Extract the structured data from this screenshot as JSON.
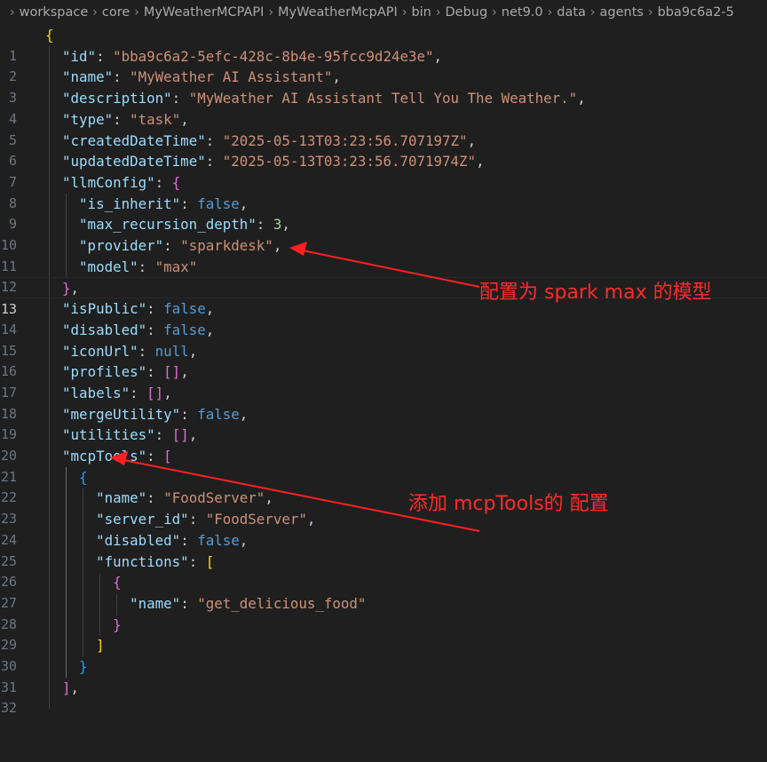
{
  "breadcrumb": [
    "workspace",
    "core",
    "MyWeatherMCPAPI",
    "MyWeatherMcpAPI",
    "bin",
    "Debug",
    "net9.0",
    "data",
    "agents",
    "bba9c6a2-5"
  ],
  "line_numbers": [
    "1",
    "2",
    "3",
    "4",
    "5",
    "6",
    "7",
    "8",
    "9",
    "10",
    "11",
    "12",
    "13",
    "14",
    "15",
    "16",
    "17",
    "18",
    "19",
    "20",
    "21",
    "22",
    "23",
    "24",
    "25",
    "26",
    "27",
    "28",
    "29",
    "30",
    "31",
    "32"
  ],
  "code": {
    "id": {
      "key": "\"id\"",
      "value": "\"bba9c6a2-5efc-428c-8b4e-95fcc9d24e3e\""
    },
    "name": {
      "key": "\"name\"",
      "value": "\"MyWeather AI Assistant\""
    },
    "description": {
      "key": "\"description\"",
      "value": "\"MyWeather AI Assistant Tell You The Weather.\""
    },
    "type": {
      "key": "\"type\"",
      "value": "\"task\""
    },
    "createdDateTime": {
      "key": "\"createdDateTime\"",
      "value": "\"2025-05-13T03:23:56.707197Z\""
    },
    "updatedDateTime": {
      "key": "\"updatedDateTime\"",
      "value": "\"2025-05-13T03:23:56.7071974Z\""
    },
    "llmConfig": {
      "key": "\"llmConfig\""
    },
    "is_inherit": {
      "key": "\"is_inherit\"",
      "value": "false"
    },
    "max_recursion_depth": {
      "key": "\"max_recursion_depth\"",
      "value": "3"
    },
    "provider": {
      "key": "\"provider\"",
      "value": "\"sparkdesk\""
    },
    "model": {
      "key": "\"model\"",
      "value": "\"max\""
    },
    "isPublic": {
      "key": "\"isPublic\"",
      "value": "false"
    },
    "disabled": {
      "key": "\"disabled\"",
      "value": "false"
    },
    "iconUrl": {
      "key": "\"iconUrl\"",
      "value": "null"
    },
    "profiles": {
      "key": "\"profiles\""
    },
    "labels": {
      "key": "\"labels\""
    },
    "mergeUtility": {
      "key": "\"mergeUtility\"",
      "value": "false"
    },
    "utilities": {
      "key": "\"utilities\""
    },
    "mcpTools": {
      "key": "\"mcpTools\""
    },
    "tool_name": {
      "key": "\"name\"",
      "value": "\"FoodServer\""
    },
    "server_id": {
      "key": "\"server_id\"",
      "value": "\"FoodServer\""
    },
    "tool_disabled": {
      "key": "\"disabled\"",
      "value": "false"
    },
    "functions": {
      "key": "\"functions\""
    },
    "func_name": {
      "key": "\"name\"",
      "value": "\"get_delicious_food\""
    }
  },
  "annotations": {
    "model_note": "配置为 spark max 的模型",
    "mcp_note": "添加 mcpTools的 配置"
  },
  "colors": {
    "background": "#1f1f1f",
    "json_key": "#9cdcfe",
    "json_string": "#ce9178",
    "json_keyword": "#569cd6",
    "json_number": "#b5cea8",
    "bracket_level1": "#ffd700",
    "bracket_level2": "#da70d6",
    "bracket_level3": "#179fff",
    "annotation": "#ff2a2a"
  }
}
